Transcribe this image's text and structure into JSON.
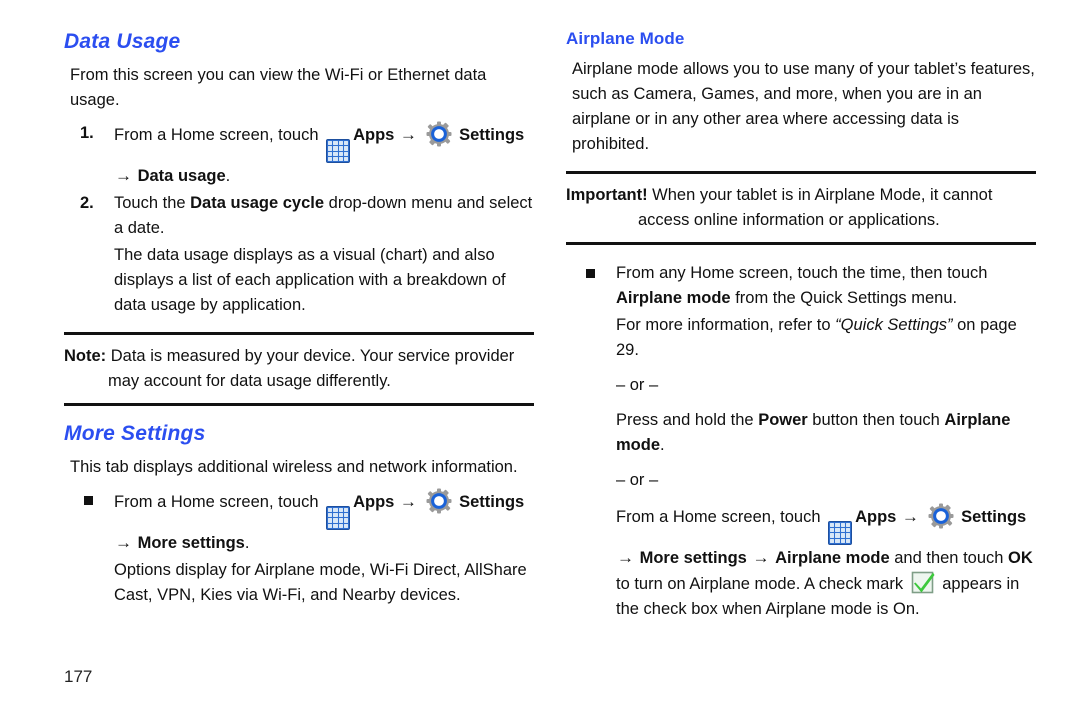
{
  "page": {
    "number": "177",
    "heading_color": "#2b4ef0",
    "text_color": "#111111"
  },
  "icons": {
    "apps": "apps-grid-icon",
    "settings": "settings-gear-icon",
    "check": "green-checkmark-icon",
    "arrow": "→"
  },
  "left_column": {
    "section_heading": "Data Usage",
    "intro": "From this screen you can view the Wi-Fi or Ethernet data usage.",
    "steps": [
      {
        "marker": "1.",
        "pre_apps": "From a Home screen, touch ",
        "apps_label": "Apps",
        "settings_label": "Settings",
        "trail_arrow": "→",
        "trail_bold": "Data usage",
        "trail_period": "."
      },
      {
        "marker": "2.",
        "text_pre": "Touch the ",
        "text_bold": "Data usage cycle",
        "text_post": " drop-down menu and select a date."
      }
    ],
    "step2_detail": "The data usage displays as a visual (chart) and also displays a list of each application with a breakdown of data usage by application.",
    "note": {
      "label": "Note:",
      "text": " Data is measured by your device. Your service provider may account for data usage differently."
    },
    "more_settings": {
      "section_heading": "More Settings",
      "intro": "This tab displays additional wireless and network information.",
      "bullet": {
        "marker": "square-bullet",
        "pre_apps": "From a Home screen, touch ",
        "apps_label": "Apps",
        "settings_label": "Settings",
        "trail_arrow": "→",
        "trail_bold": "More settings",
        "trail_period": "."
      },
      "detail": "Options display for Airplane mode, Wi-Fi Direct, AllShare Cast, VPN, Kies via Wi-Fi, and Nearby devices."
    }
  },
  "right_column": {
    "sub_heading": "Airplane Mode",
    "intro": "Airplane mode allows you to use many of your tablet’s features, such as Camera, Games, and more, when you are in an airplane or in any other area where accessing data is prohibited.",
    "important": {
      "label": "Important!",
      "text": " When your tablet is in Airplane Mode, it cannot access online information or applications."
    },
    "bullet1": {
      "marker": "square-bullet",
      "line1_pre": "From any Home screen, touch the time, then touch ",
      "line1_bold": "Airplane mode",
      "line1_post": " from the Quick Settings menu."
    },
    "more_info": {
      "pre": "For more information, refer to ",
      "italic": "“Quick Settings”",
      "post": " on page 29."
    },
    "or_1": "– or –",
    "power_option": {
      "pre": "Press and hold the ",
      "bold1": "Power",
      "mid": " button then touch ",
      "bold2": "Airplane mode",
      "post": "."
    },
    "or_2": "– or –",
    "settings_path": {
      "pre_apps": "From a Home screen, touch ",
      "apps_label": "Apps",
      "settings_label": "Settings",
      "arrow": "→",
      "bold_more": "More settings",
      "bold_airplane": "Airplane mode",
      "mid": " and then touch ",
      "bold_ok": "OK",
      "post": " to turn on Airplane mode. A check mark ",
      "tail": " appears in the check box when Airplane mode is On."
    }
  }
}
